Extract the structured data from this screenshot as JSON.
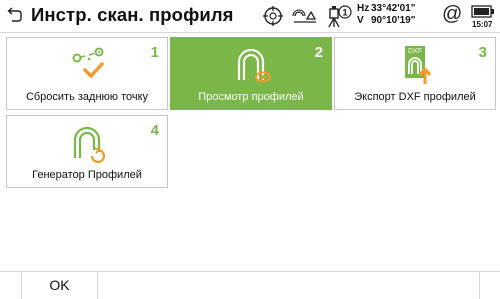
{
  "header": {
    "title": "Инстр. скан. профиля",
    "icons": [
      "back-icon",
      "target-icon",
      "prism-search-icon",
      "instrument-icon",
      "at-icon",
      "battery-icon"
    ],
    "instrument_badge": "1",
    "hz_label": "Hz",
    "hz_value": "33°42'01\"",
    "v_label": "V",
    "v_value": "90°10'19\"",
    "at_symbol": "@",
    "time": "15:07"
  },
  "tiles": [
    {
      "number": "1",
      "label": "Сбросить заднюю точку",
      "icon": "reset-backsight-icon",
      "selected": false
    },
    {
      "number": "2",
      "label": "Просмотр профилей",
      "icon": "view-profiles-icon",
      "selected": true
    },
    {
      "number": "3",
      "label": "Экспорт DXF профилей",
      "icon": "export-dxf-icon",
      "icon_text": "DXF",
      "selected": false
    },
    {
      "number": "4",
      "label": "Генератор Профилей",
      "icon": "profile-generator-icon",
      "selected": false
    }
  ],
  "footer": {
    "ok_label": "OK"
  },
  "colors": {
    "accent_green": "#7ab648",
    "accent_orange": "#f29a2e",
    "border": "#c6c6c6"
  }
}
